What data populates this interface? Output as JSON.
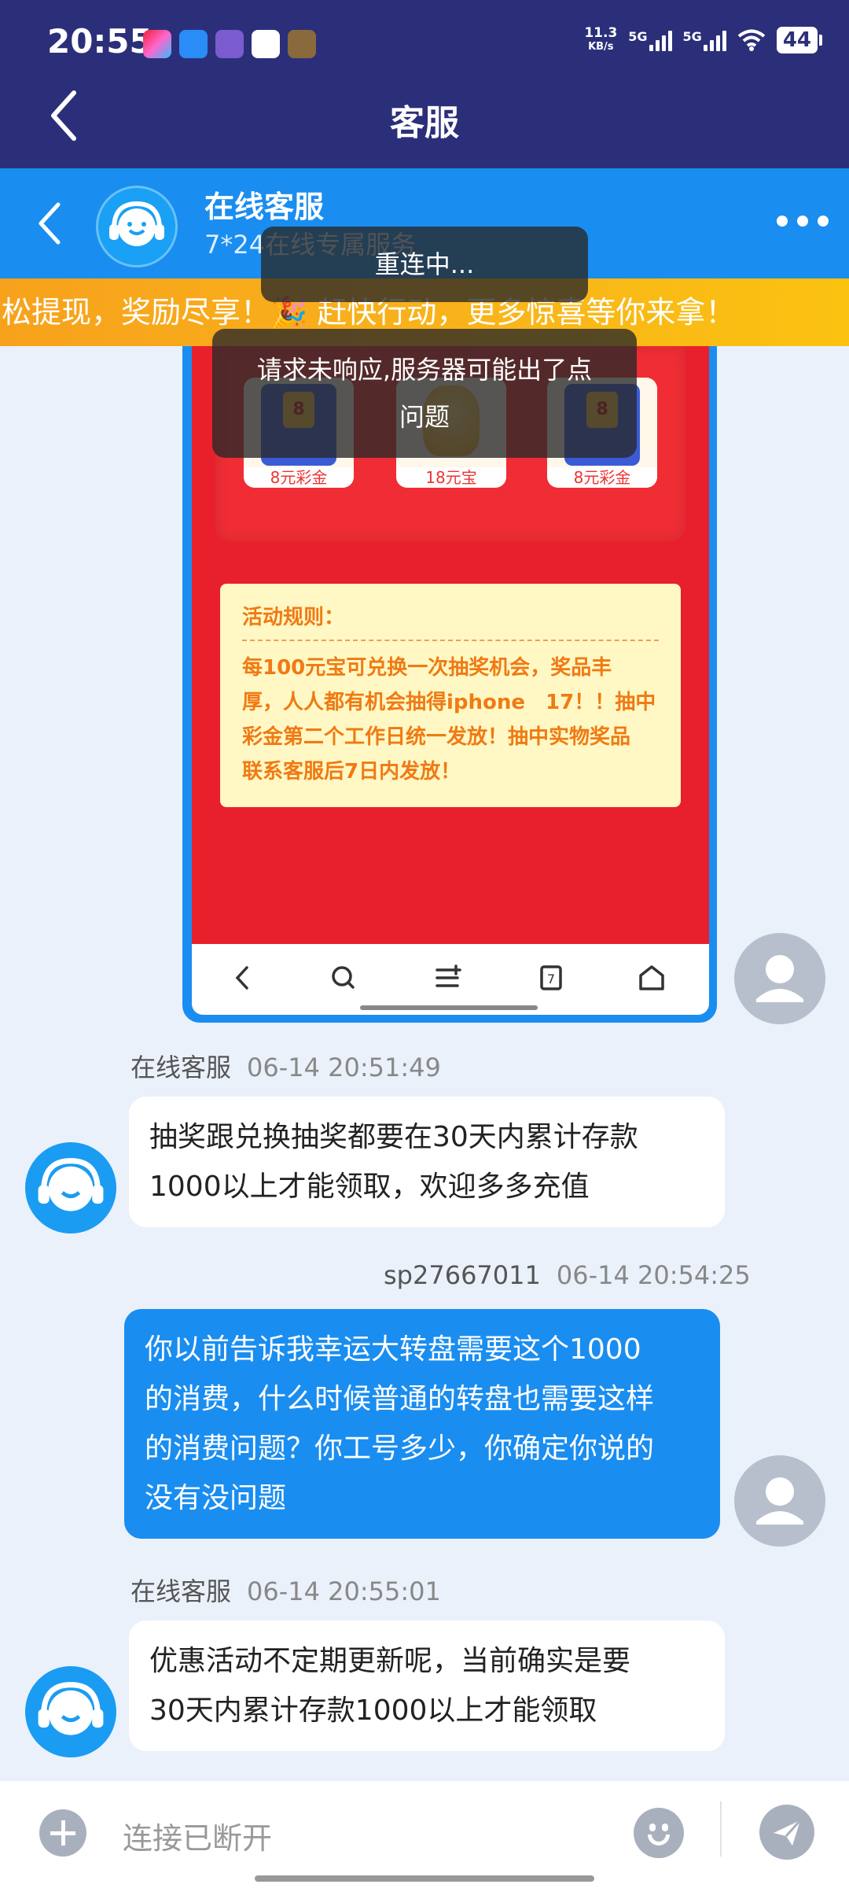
{
  "status_bar": {
    "time": "20:55",
    "speed_value": "11.3",
    "speed_unit": "KB/s",
    "signal_1": "5G",
    "signal_2": "5G",
    "battery": "44"
  },
  "app_header": {
    "title": "客服"
  },
  "chat_header": {
    "name": "在线客服",
    "subtitle": "7*24在线专属服务"
  },
  "marquee": {
    "text": "松提现，奖励尽享！🎉 赶快行动，更多惊喜等你来拿！"
  },
  "image_message": {
    "prizes": [
      {
        "badge": "8",
        "label": "8元彩金"
      },
      {
        "badge": "",
        "label": "18元宝"
      },
      {
        "badge": "8",
        "label": "8元彩金"
      }
    ],
    "rules_title": "活动规则：",
    "rules_lines": [
      "每100元宝可兑换一次抽奖机会，奖品丰",
      "厚，人人都有机会抽得iphone　17！！抽中",
      "彩金第二个工作日统一发放！抽中实物奖品",
      "联系客服后7日内发放！"
    ]
  },
  "messages": [
    {
      "sender": "在线客服",
      "time": "06-14 20:51:49",
      "lines": [
        "抽奖跟兑换抽奖都要在30天内累计存款",
        "1000以上才能领取，欢迎多多充值"
      ]
    },
    {
      "sender": "sp27667011",
      "time": "06-14 20:54:25",
      "lines": [
        "你以前告诉我幸运大转盘需要这个1000",
        "的消费，什么时候普通的转盘也需要这样",
        "的消费问题？你工号多少，你确定你说的",
        "没有没问题"
      ]
    },
    {
      "sender": "在线客服",
      "time": "06-14 20:55:01",
      "lines": [
        "优惠活动不定期更新呢，当前确实是要",
        "30天内累计存款1000以上才能领取"
      ]
    }
  ],
  "toasts": {
    "reconnecting": "重连中...",
    "error_line1": "请求未响应,服务器可能出了点",
    "error_line2": "问题"
  },
  "input_bar": {
    "placeholder": "连接已断开"
  },
  "colors": {
    "primary": "#1a8df0",
    "header": "#2b2f7a",
    "marquee": "#f9b51a",
    "promo_red": "#e8202c"
  }
}
